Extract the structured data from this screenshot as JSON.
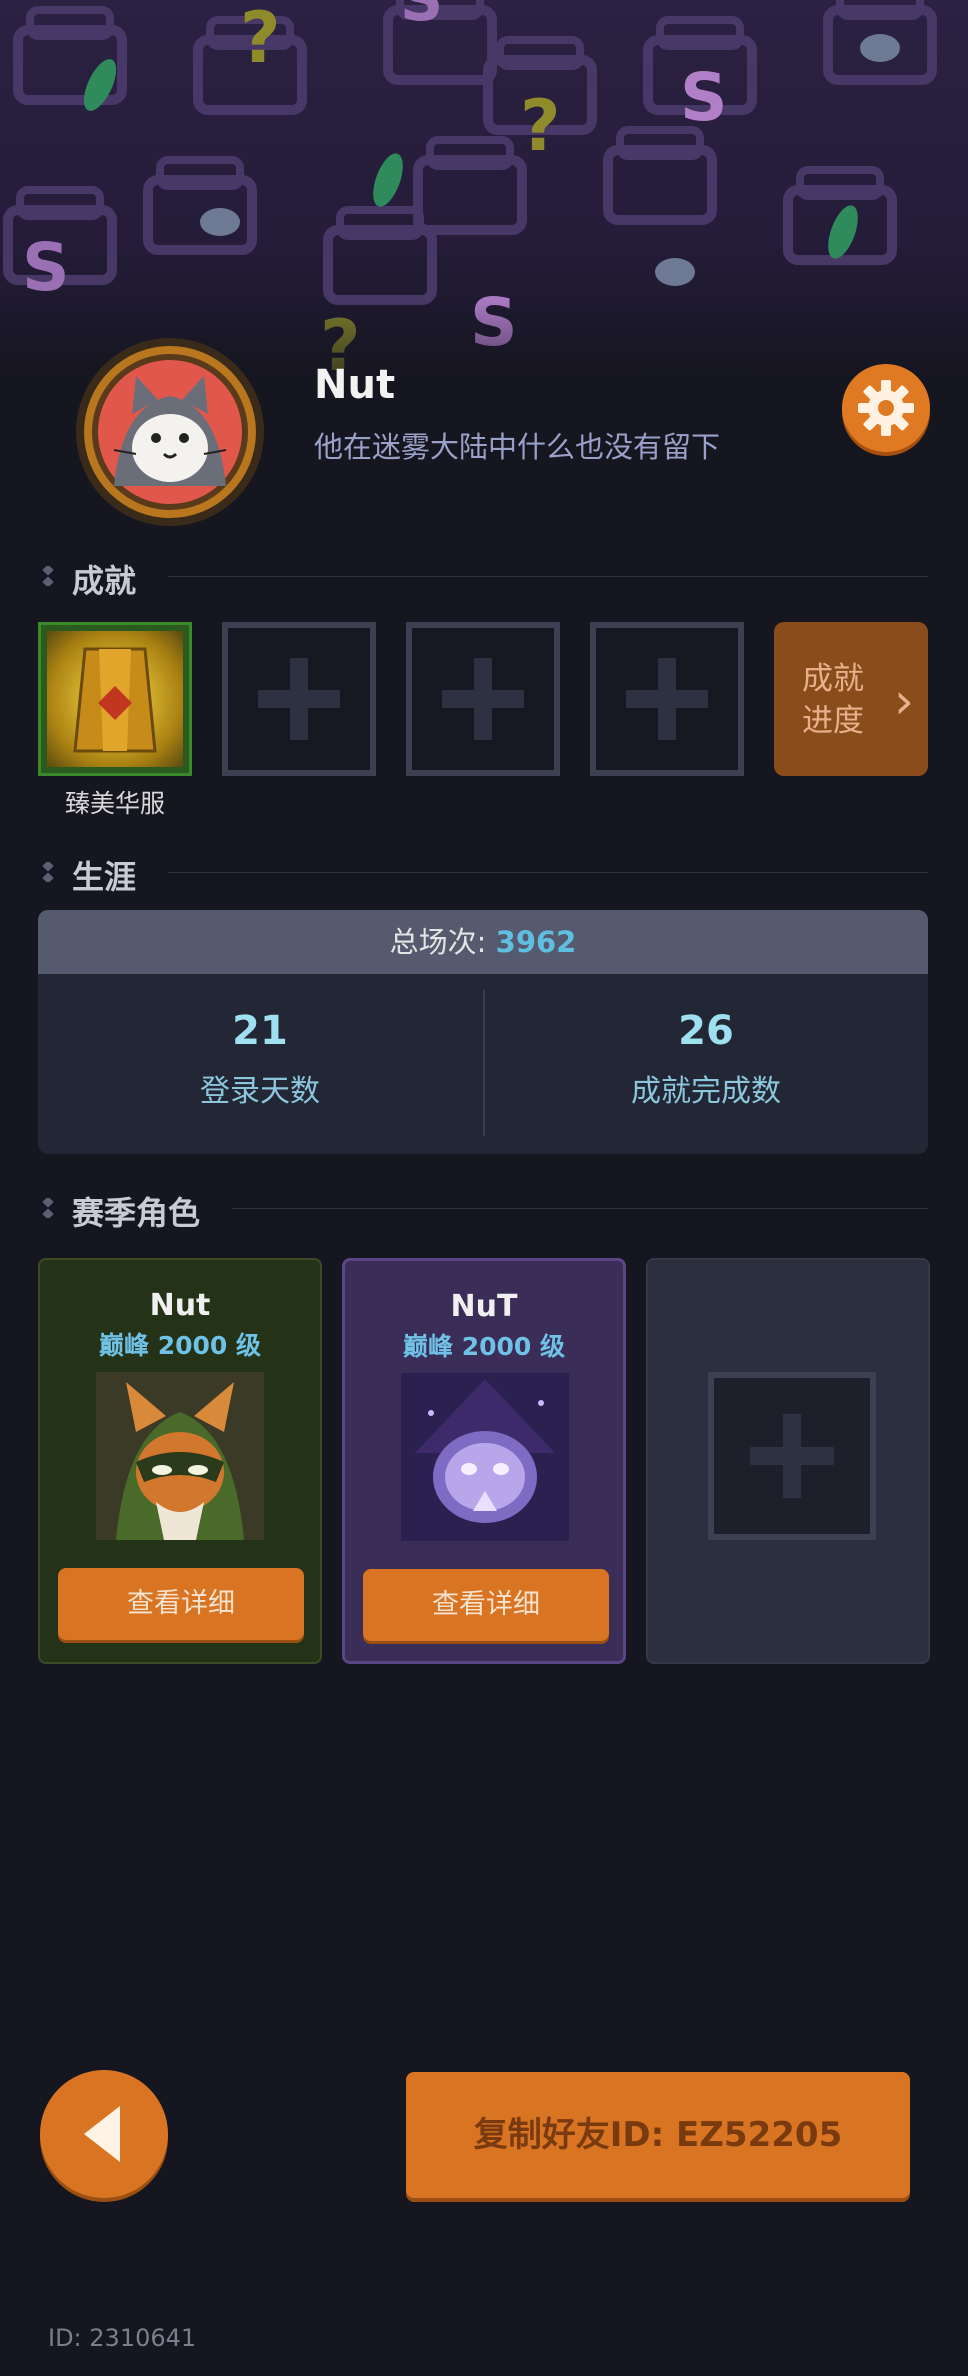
{
  "profile": {
    "name": "Nut",
    "motto": "他在迷雾大陆中什么也没有留下"
  },
  "icons": {
    "settings": "gear-icon",
    "back": "back-arrow-icon",
    "add": "plus-icon",
    "chevron": "chevron-right-icon"
  },
  "achievements": {
    "title": "成就",
    "filled": [
      {
        "label": "臻美华服"
      }
    ],
    "empty_slots": 3,
    "progress_label_line1": "成就",
    "progress_label_line2": "进度",
    "progress_chevron": "›"
  },
  "career": {
    "title": "生涯",
    "total_label": "总场次: ",
    "total_value": "3962",
    "stats": [
      {
        "value": "21",
        "label": "登录天数"
      },
      {
        "value": "26",
        "label": "成就完成数"
      }
    ]
  },
  "season": {
    "title": "赛季角色",
    "characters": [
      {
        "name": "Nut",
        "level": "巅峰 2000 级",
        "button": "查看详细"
      },
      {
        "name": "NuT",
        "level": "巅峰 2000 级",
        "button": "查看详细"
      }
    ]
  },
  "footer": {
    "copy_button": "复制好友ID: EZ52205",
    "user_id": "ID: 2310641"
  },
  "colors": {
    "accent": "#d97522",
    "background": "#15161f",
    "highlight_number": "#5fbfe0"
  }
}
